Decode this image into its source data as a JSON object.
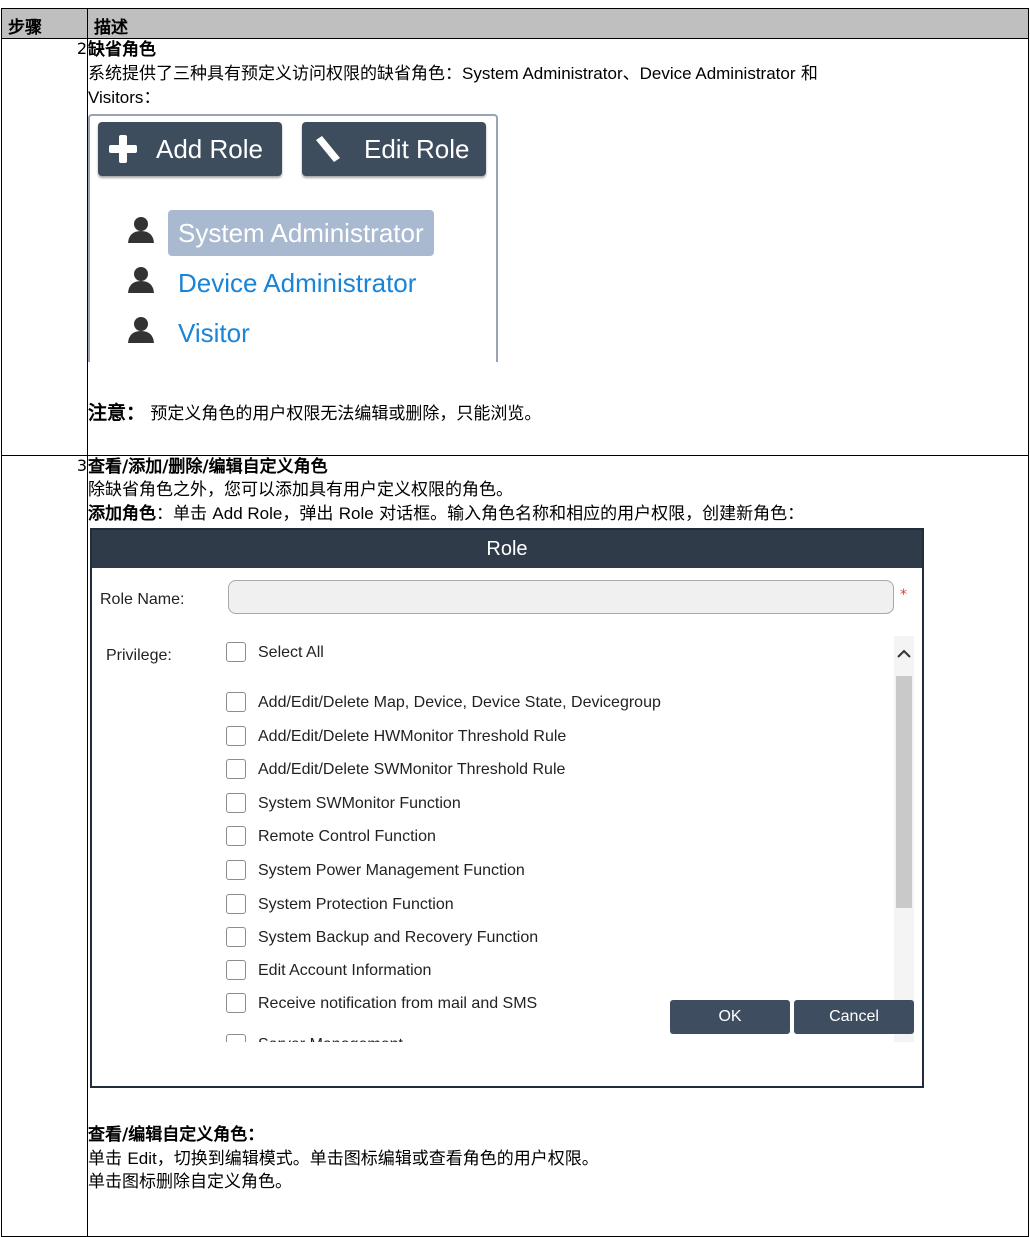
{
  "table": {
    "header": {
      "col_step": "步骤",
      "col_desc": "描述"
    }
  },
  "step2": {
    "number": "2",
    "title": "缺省角色",
    "text_before": "系统提供了三种具有预定义访问权限的缺省角色：",
    "role1": "System Administrator",
    "sep": "、",
    "role2": "Device Administrator",
    "and": " 和",
    "role3": "Visitors",
    "colon": "：",
    "panel": {
      "add_role": "Add Role",
      "edit_role": "Edit Role",
      "roles": [
        "System Administrator",
        "Device Administrator",
        "Visitor"
      ]
    },
    "note_label": "注意：",
    "note_text": " 预定义角色的用户权限无法编辑或删除，只能浏览。"
  },
  "step3": {
    "number": "3",
    "title": "查看/添加/删除/编辑自定义角色",
    "line1": "除缺省角色之外，您可以添加具有用户定义权限的角色。",
    "add_label": "添加角色",
    "add_t1": "：单击 ",
    "add_btn": "Add Role",
    "add_t2": "，弹出 ",
    "add_dialog": "Role",
    "add_t3": " 对话框。输入角色名称和相应的用户权限，创建新角色：",
    "dialog": {
      "title": "Role",
      "role_name_label": "Role Name:",
      "required_mark": "*",
      "privilege_label": "Privilege:",
      "select_all": "Select All",
      "privileges": [
        "Add/Edit/Delete Map, Device, Device State, Devicegroup",
        "Add/Edit/Delete HWMonitor Threshold Rule",
        "Add/Edit/Delete SWMonitor Threshold Rule",
        "System SWMonitor Function",
        "Remote Control Function",
        "System Power Management Function",
        "System Protection Function",
        "System Backup and Recovery Function",
        "Edit Account Information",
        "Receive notification from mail and SMS",
        "Server Management"
      ],
      "ok": "OK",
      "cancel": "Cancel"
    },
    "view_label": "查看/编辑自定义角色：",
    "view_t1": "单击 ",
    "view_edit": "Edit",
    "view_t2": "，切换到编辑模式。单击图标编辑或查看角色的用户权限。",
    "delete_text": "单击图标删除自定义角色。"
  }
}
